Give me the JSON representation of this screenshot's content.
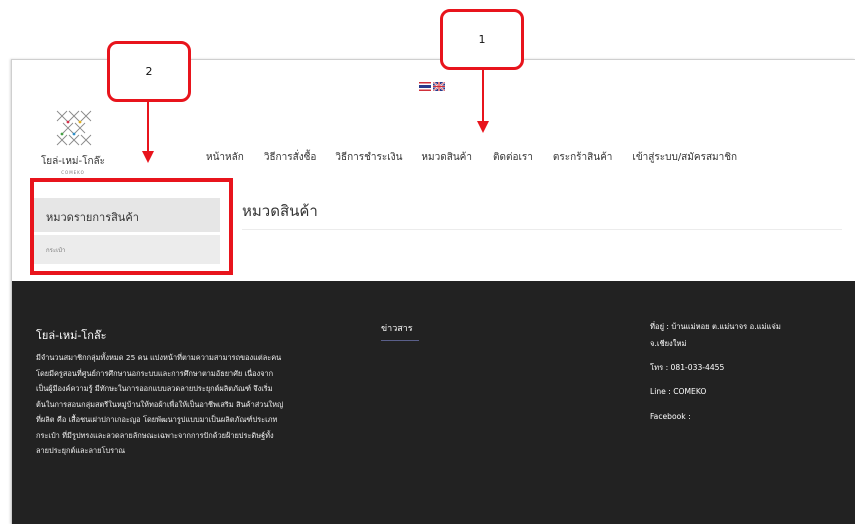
{
  "header": {
    "flags": [
      {
        "icon": "thailand-flag-icon",
        "language": "th"
      },
      {
        "icon": "uk-flag-icon",
        "language": "en"
      }
    ],
    "logo": {
      "name": "โยล่-เหม่-โกล๊ะ",
      "sub": "COMEKO",
      "colors": [
        "#8a8a8a",
        "#d4304a",
        "#e0b020",
        "#2f8fc8",
        "#47a046"
      ]
    },
    "nav": [
      {
        "label": "หน้าหลัก"
      },
      {
        "label": "วิธีการสั่งซื้อ"
      },
      {
        "label": "วิธีการชำระเงิน"
      },
      {
        "label": "หมวดสินค้า"
      },
      {
        "label": "ติดต่อเรา"
      },
      {
        "label": "ตระกร้าสินค้า"
      },
      {
        "label": "เข้าสู่ระบบ/สมัครสมาชิก"
      }
    ]
  },
  "sidebar": {
    "title": "หมวดรายการสินค้า",
    "items": [
      {
        "label": "กระเป๋า"
      }
    ]
  },
  "main": {
    "title": "หมวดสินค้า"
  },
  "footer": {
    "brand": "โยล่-เหม่-โกล๊ะ",
    "description_lines": [
      "มีจำนวนสมาชิกกลุ่มทั้งหมด 25 คน แบ่งหน้าที่ตามความสามารถของแต่ละคน",
      "โดยมีครูสอนที่ศูนย์การศึกษานอกระบบและการศึกษาตามอัธยาศัย เนื่องจาก",
      "เป็นผู้มีองค์ความรู้ มีทักษะในการออกแบบลวดลายประยุกต์ผลิตภัณฑ์ จึงเริ่ม",
      "ต้นในการสอนกลุ่มสตรีในหมู่บ้านให้ทอผ้าเพื่อให้เป็นอาชีพเสริม สินค้าส่วนใหญ่",
      "ที่ผลิต คือ เสื้อชนเผ่าปกาเกอะญอ โดยพัฒนารูปแบบมาเป็นผลิตภัณฑ์ประเภท",
      "กระเป๋า ที่มีรูปทรงและลวดลายลักษณะเฉพาะจากการปักด้วยฝ้ายประดิษฐ์ทั้ง",
      "ลายประยุกต์และลายโบราณ"
    ],
    "news_title": "ข่าวสาร",
    "contact": {
      "address_line1": "ที่อยู่ : บ้านแม่หอย ต.แม่นาจร อ.แม่แจ่ม",
      "address_line2": "จ.เชียงใหม่",
      "tel": "โทร : 081-033-4455",
      "line": "Line : COMEKO",
      "facebook": "Facebook :"
    }
  },
  "annotations": {
    "callout1": "1",
    "callout2": "2",
    "color": "#e8141c"
  }
}
